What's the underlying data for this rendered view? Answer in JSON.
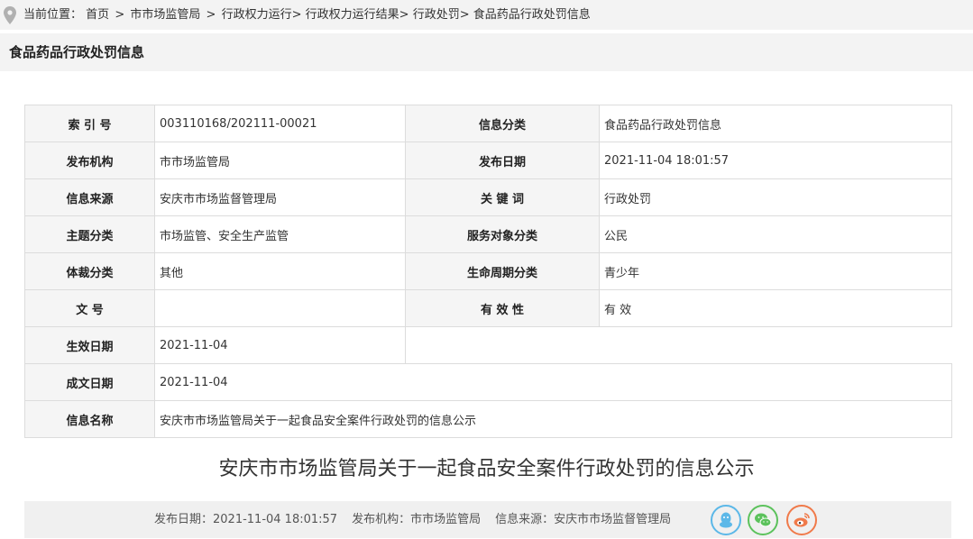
{
  "breadcrumb": {
    "prefix": "当前位置：",
    "items": [
      "首页",
      "市市场监管局",
      "行政权力运行",
      "行政权力运行结果",
      "行政处罚",
      "食品药品行政处罚信息"
    ]
  },
  "page_title": "食品药品行政处罚信息",
  "info_table": {
    "index_no_label": "索 引 号",
    "index_no": "003110168/202111-00021",
    "category_label": "信息分类",
    "category": "食品药品行政处罚信息",
    "publisher_label": "发布机构",
    "publisher": "市市场监管局",
    "publish_date_label": "发布日期",
    "publish_date": "2021-11-04 18:01:57",
    "source_label": "信息来源",
    "source": "安庆市市场监督管理局",
    "keywords_label": "关 键 词",
    "keywords": "行政处罚",
    "topic_label": "主题分类",
    "topic": "市场监管、安全生产监管",
    "audience_label": "服务对象分类",
    "audience": "公民",
    "genre_label": "体裁分类",
    "genre": "其他",
    "lifecycle_label": "生命周期分类",
    "lifecycle": "青少年",
    "doc_no_label": "文 号",
    "doc_no": "",
    "validity_label": "有 效 性",
    "validity": "有 效",
    "effective_date_label": "生效日期",
    "effective_date": "2021-11-04",
    "written_date_label": "成文日期",
    "written_date": "2021-11-04",
    "info_name_label": "信息名称",
    "info_name": "安庆市市场监管局关于一起食品安全案件行政处罚的信息公示"
  },
  "article": {
    "heading": "安庆市市场监管局关于一起食品安全案件行政处罚的信息公示",
    "meta_date": "发布日期：2021-11-04 18:01:57",
    "meta_publisher": "发布机构：市市场监管局",
    "meta_source": "信息来源：安庆市市场监督管理局"
  },
  "share_icons": [
    "qq-icon",
    "wechat-icon",
    "weibo-icon"
  ],
  "colors": {
    "qq": "#5cb8e8",
    "wechat": "#5cc25c",
    "weibo": "#f07a4a",
    "header_bg": "#f3f3f3"
  }
}
